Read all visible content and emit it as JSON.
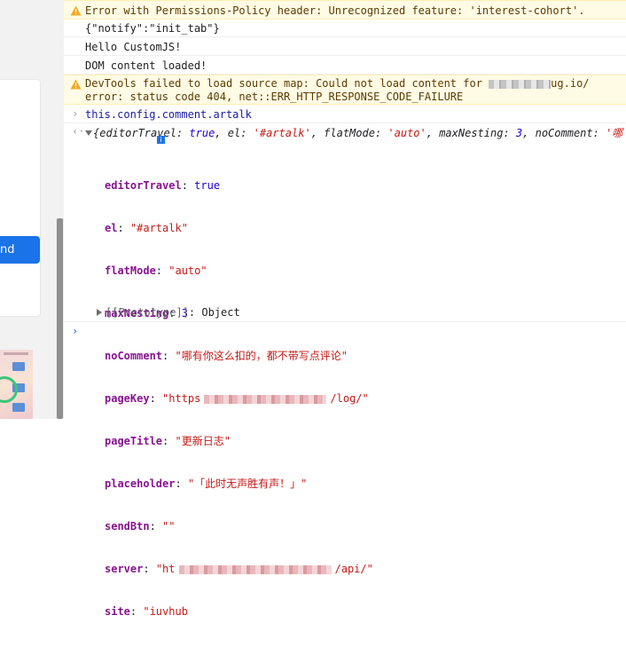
{
  "left_pane": {
    "send_button_label": "nd"
  },
  "console": {
    "warning1": "Error with Permissions-Policy header: Unrecognized feature: 'interest-cohort'.",
    "log1": "{\"notify\":\"init_tab\"}",
    "log2": "Hello CustomJS!",
    "log3": "DOM content loaded!",
    "warning2_line1": "DevTools failed to load source map: Could not load content for",
    "warning2_line1_tail": "ug.io/",
    "warning2_line2": "error: status code 404, net::ERR_HTTP_RESPONSE_CODE_FAILURE",
    "command": "this.config.comment.artalk",
    "summary": {
      "open": "{",
      "editorTravel_key": "editorTravel",
      "editorTravel_val": "true",
      "el_key": "el",
      "el_val": "'#artalk'",
      "flatMode_key": "flatMode",
      "flatMode_val": "'auto'",
      "maxNesting_key": "maxNesting",
      "maxNesting_val": "3",
      "noComment_key": "noComment",
      "noComment_val": "'哪"
    },
    "props": [
      {
        "key": "editorTravel",
        "value": "true",
        "kind": "kw"
      },
      {
        "key": "el",
        "value": "\"#artalk\"",
        "kind": "str"
      },
      {
        "key": "flatMode",
        "value": "\"auto\"",
        "kind": "str"
      },
      {
        "key": "maxNesting",
        "value": "3",
        "kind": "num"
      },
      {
        "key": "noComment",
        "value": "\"哪有你这么扣的，都不带写点评论\"",
        "kind": "str"
      },
      {
        "key": "pageKey",
        "value_start": "\"https",
        "value_end": "/log/\"",
        "kind": "str"
      },
      {
        "key": "pageTitle",
        "value": "\"更新日志\"",
        "kind": "str"
      },
      {
        "key": "placeholder",
        "value": "\"「此时无声胜有声！」\"",
        "kind": "str"
      },
      {
        "key": "sendBtn",
        "value": "\"\"",
        "kind": "str"
      },
      {
        "key": "server",
        "value_start": "\"ht",
        "value_end": "/api/\"",
        "kind": "str"
      },
      {
        "key": "site",
        "value": "\"iuvhub",
        "kind": "str"
      }
    ],
    "prototype_label": "[[Prototype]]",
    "prototype_value": "Object",
    "separator": ": "
  },
  "colors": {
    "warning_bg": "#fffbe5",
    "string": "#c41a16",
    "key": "#881391",
    "keyword": "#1c00cf",
    "accent": "#1a73e8"
  }
}
